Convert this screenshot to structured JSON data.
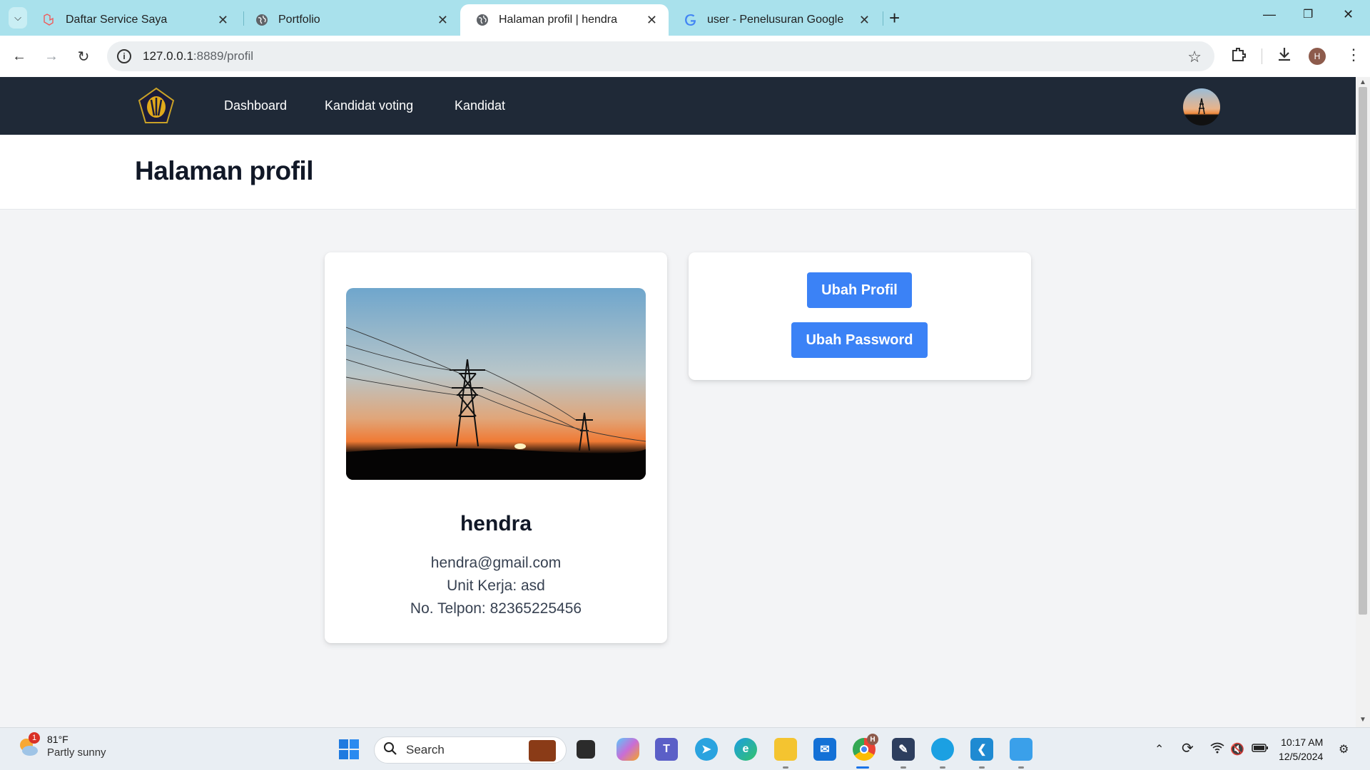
{
  "browser": {
    "tabs": [
      {
        "title": "Daftar Service Saya",
        "active": false
      },
      {
        "title": "Portfolio",
        "active": false
      },
      {
        "title": "Halaman profil | hendra",
        "active": true
      },
      {
        "title": "user - Penelusuran Google",
        "active": false
      }
    ],
    "url_host": "127.0.0.1",
    "url_path": ":8889/profil",
    "profile_initial": "H"
  },
  "app": {
    "nav_links": [
      "Dashboard",
      "Kandidat voting",
      "Kandidat"
    ],
    "page_title": "Halaman profil",
    "profile": {
      "name": "hendra",
      "email": "hendra@gmail.com",
      "unit_kerja": "Unit Kerja: asd",
      "telpon": "No. Telpon: 82365225456"
    },
    "actions": {
      "edit_profile": "Ubah Profil",
      "edit_password": "Ubah Password"
    },
    "colors": {
      "nav_bg": "#1f2937",
      "button": "#3b82f6",
      "page_bg": "#f3f4f6"
    }
  },
  "taskbar": {
    "weather_temp": "81°F",
    "weather_desc": "Partly sunny",
    "weather_badge": "1",
    "search_label": "Search",
    "time": "10:17 AM",
    "date": "12/5/2024",
    "chrome_badge": "H"
  }
}
